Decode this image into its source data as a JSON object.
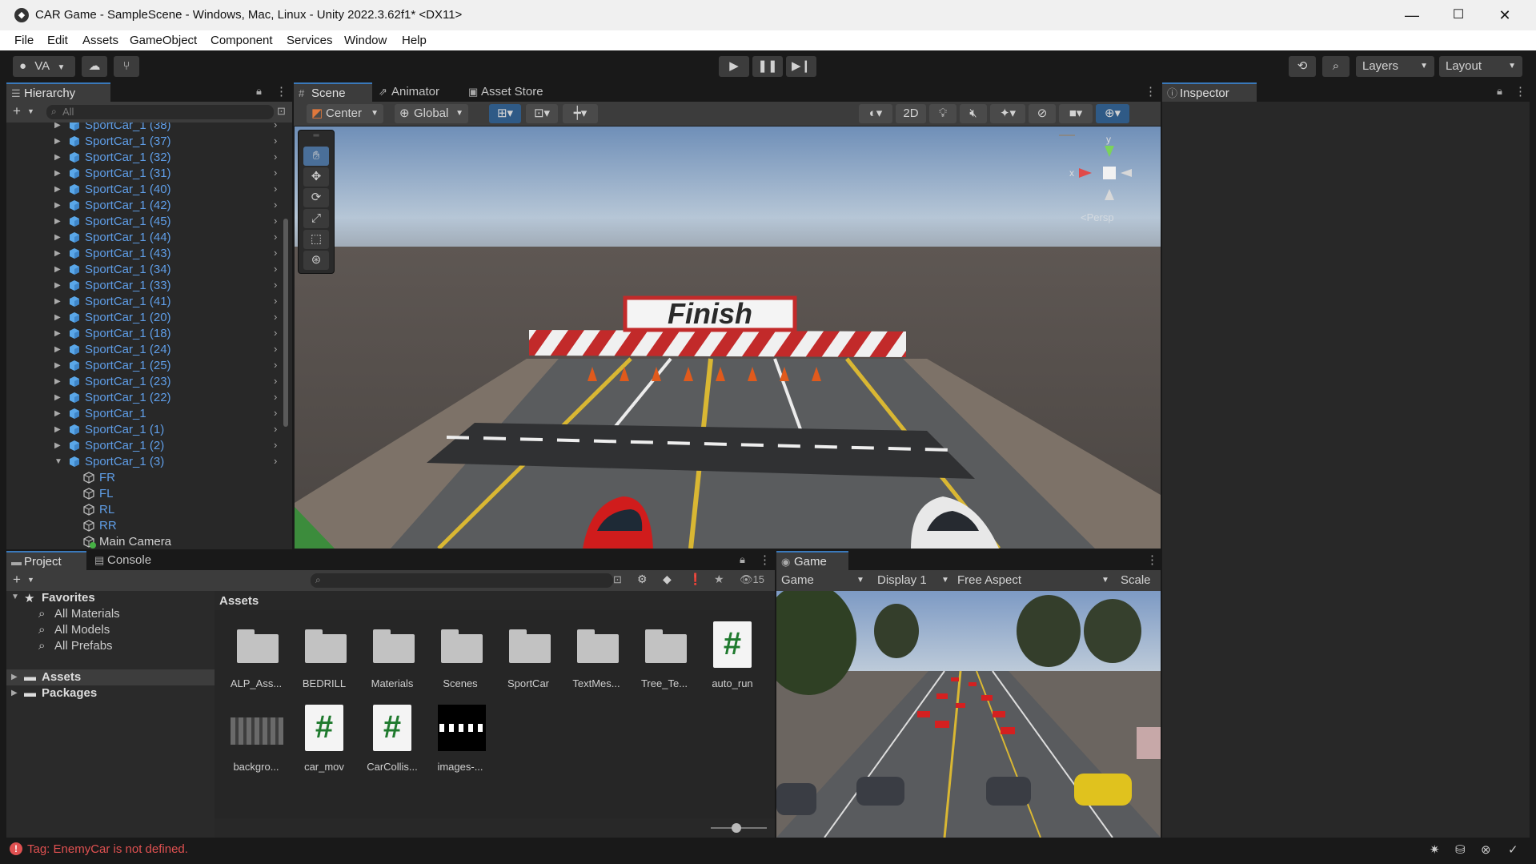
{
  "window": {
    "title": "CAR Game - SampleScene - Windows, Mac, Linux - Unity 2022.3.62f1* <DX11>"
  },
  "menu": [
    "File",
    "Edit",
    "Assets",
    "GameObject",
    "Component",
    "Services",
    "Window",
    "Help"
  ],
  "toolbar": {
    "account": "VA",
    "layers": "Layers",
    "layout": "Layout"
  },
  "hierarchy": {
    "tab": "Hierarchy",
    "search_placeholder": "All",
    "items": [
      {
        "label": "SportCar_1 (38)",
        "child": false
      },
      {
        "label": "SportCar_1 (37)",
        "child": false
      },
      {
        "label": "SportCar_1 (32)",
        "child": false
      },
      {
        "label": "SportCar_1 (31)",
        "child": false
      },
      {
        "label": "SportCar_1 (40)",
        "child": false
      },
      {
        "label": "SportCar_1 (42)",
        "child": false
      },
      {
        "label": "SportCar_1 (45)",
        "child": false
      },
      {
        "label": "SportCar_1 (44)",
        "child": false
      },
      {
        "label": "SportCar_1 (43)",
        "child": false
      },
      {
        "label": "SportCar_1 (34)",
        "child": false
      },
      {
        "label": "SportCar_1 (33)",
        "child": false
      },
      {
        "label": "SportCar_1 (41)",
        "child": false
      },
      {
        "label": "SportCar_1 (20)",
        "child": false
      },
      {
        "label": "SportCar_1 (18)",
        "child": false
      },
      {
        "label": "SportCar_1 (24)",
        "child": false
      },
      {
        "label": "SportCar_1 (25)",
        "child": false
      },
      {
        "label": "SportCar_1 (23)",
        "child": false
      },
      {
        "label": "SportCar_1 (22)",
        "child": false
      },
      {
        "label": "SportCar_1",
        "child": false
      },
      {
        "label": "SportCar_1 (1)",
        "child": false
      },
      {
        "label": "SportCar_1 (2)",
        "child": false
      },
      {
        "label": "SportCar_1 (3)",
        "child": false,
        "expanded": true
      },
      {
        "label": "FR",
        "child": true
      },
      {
        "label": "FL",
        "child": true
      },
      {
        "label": "RL",
        "child": true
      },
      {
        "label": "RR",
        "child": true
      },
      {
        "label": "Main Camera",
        "child": true,
        "camera": true
      }
    ]
  },
  "scene_tabs": {
    "scene": "Scene",
    "animator": "Animator",
    "asset_store": "Asset Store"
  },
  "scene_toolbar": {
    "pivot": "Center",
    "space": "Global",
    "mode_2d": "2D"
  },
  "scene_view": {
    "sign_text": "Finish",
    "persp": "<Persp",
    "axis_x": "x",
    "axis_y": "y"
  },
  "inspector": {
    "tab": "Inspector"
  },
  "project": {
    "tab_project": "Project",
    "tab_console": "Console",
    "hidden_count": "15",
    "tree": {
      "favorites": "Favorites",
      "fav_items": [
        "All Materials",
        "All Models",
        "All Prefabs"
      ],
      "assets": "Assets",
      "packages": "Packages"
    },
    "breadcrumb": "Assets",
    "assets": [
      {
        "label": "ALP_Ass...",
        "kind": "folder"
      },
      {
        "label": "BEDRILL",
        "kind": "folder"
      },
      {
        "label": "Materials",
        "kind": "folder"
      },
      {
        "label": "Scenes",
        "kind": "folder"
      },
      {
        "label": "SportCar",
        "kind": "folder"
      },
      {
        "label": "TextMes...",
        "kind": "folder"
      },
      {
        "label": "Tree_Te...",
        "kind": "folder"
      },
      {
        "label": "auto_run",
        "kind": "script"
      },
      {
        "label": "backgro...",
        "kind": "image"
      },
      {
        "label": "car_mov",
        "kind": "script"
      },
      {
        "label": "CarCollis...",
        "kind": "script"
      },
      {
        "label": "images-...",
        "kind": "checker"
      }
    ]
  },
  "game": {
    "tab": "Game",
    "mode": "Game",
    "display": "Display 1",
    "aspect": "Free Aspect",
    "scale": "Scale"
  },
  "status": {
    "error": "Tag: EnemyCar is not defined.",
    "error_color": "#e05151"
  },
  "colors": {
    "accent": "#3a79bb",
    "hierarchy_text": "#5f9ee8"
  }
}
